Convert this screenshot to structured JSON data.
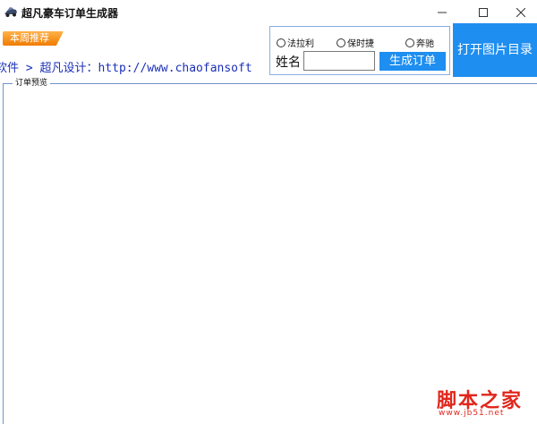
{
  "window": {
    "title": "超凡豪车订单生成器",
    "icon": "car-icon"
  },
  "promo": {
    "label": "本周推荐"
  },
  "marquee": {
    "text": "软件 > 超凡设计：http://www.chaofansoft"
  },
  "options": {
    "radios": [
      {
        "label": "法拉利",
        "checked": false
      },
      {
        "label": "保时捷",
        "checked": false
      },
      {
        "label": "奔驰",
        "checked": false
      }
    ],
    "name_label": "姓名",
    "name_value": "",
    "generate_label": "生成订单"
  },
  "open_folder": {
    "label": "打开图片目录"
  },
  "preview": {
    "legend": "订单预览"
  },
  "watermark": {
    "main": "脚本之家",
    "sub": "www.jb51.net"
  },
  "colors": {
    "accent": "#1e8ef0",
    "promo": "#f07b00",
    "marquee_text": "#1a2fb8",
    "watermark": "#e1261c"
  }
}
